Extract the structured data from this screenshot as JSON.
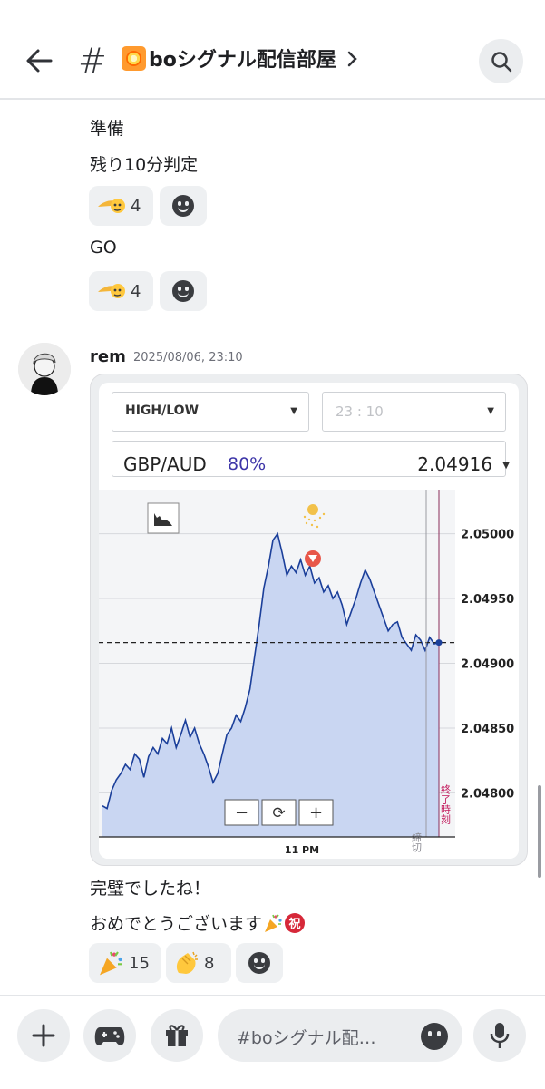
{
  "header": {
    "title": "boシグナル配信部屋",
    "title_icon": "sparkle-emoji-icon"
  },
  "messages_before": [
    {
      "text": "準備"
    },
    {
      "text": "残り10分判定",
      "reaction_count": "4"
    },
    {
      "text": "GO",
      "reaction_count": "4"
    }
  ],
  "post": {
    "author": "rem",
    "timestamp": "2025/08/06, 23:10",
    "trade": {
      "type_select": "HIGH/LOW",
      "time_select": "23 : 10",
      "pair": "GBP/AUD",
      "payout": "80%",
      "price": "2.04916",
      "x_label": "11 PM",
      "cutoff_label": "締切",
      "end_label": "終了時刻",
      "zoom_out": "−",
      "reset": "⟳",
      "zoom_in": "+"
    },
    "lines": [
      "完璧でしたね！",
      "おめでとうございます"
    ],
    "reactions": [
      {
        "emoji": "party-popper-icon",
        "count": "15"
      },
      {
        "emoji": "clapping-hands-icon",
        "count": "8"
      }
    ]
  },
  "chart_data": {
    "type": "area",
    "title": "",
    "xlabel": "",
    "ylabel": "",
    "x_tick_labels": [
      "11 PM"
    ],
    "y_ticks": [
      "2.05000",
      "2.04950",
      "2.04900",
      "2.04850",
      "2.04800"
    ],
    "ylim": [
      2.04766,
      2.05034
    ],
    "entry_price": 2.04916,
    "entry_marker": "down-triangle",
    "series": [
      {
        "values": [
          2.0479,
          2.04788,
          2.04802,
          2.0481,
          2.04815,
          2.04822,
          2.04818,
          2.0483,
          2.04826,
          2.04812,
          2.04828,
          2.04835,
          2.0483,
          2.04842,
          2.04838,
          2.0485,
          2.04835,
          2.04845,
          2.04856,
          2.04843,
          2.0485,
          2.04838,
          2.0483,
          2.0482,
          2.04808,
          2.04815,
          2.0483,
          2.04845,
          2.0485,
          2.0486,
          2.04855,
          2.04866,
          2.0488,
          2.04905,
          2.0493,
          2.04958,
          2.04975,
          2.04995,
          2.05,
          2.04985,
          2.04968,
          2.04975,
          2.0497,
          2.0498,
          2.04968,
          2.04975,
          2.04962,
          2.04966,
          2.04955,
          2.0496,
          2.0495,
          2.04955,
          2.04945,
          2.0493,
          2.0494,
          2.0495,
          2.04962,
          2.04972,
          2.04965,
          2.04955,
          2.04945,
          2.04935,
          2.04925,
          2.0493,
          2.04932,
          2.0492,
          2.04915,
          2.0491,
          2.04922,
          2.04918,
          2.0491,
          2.0492,
          2.04915,
          2.04916
        ]
      }
    ]
  },
  "composer": {
    "placeholder": "#boシグナル配…"
  },
  "colors": {
    "accent": "#3d35a8",
    "line": "#1b3f9a",
    "area": "#c9d6f2",
    "end_line": "#c2185b"
  }
}
